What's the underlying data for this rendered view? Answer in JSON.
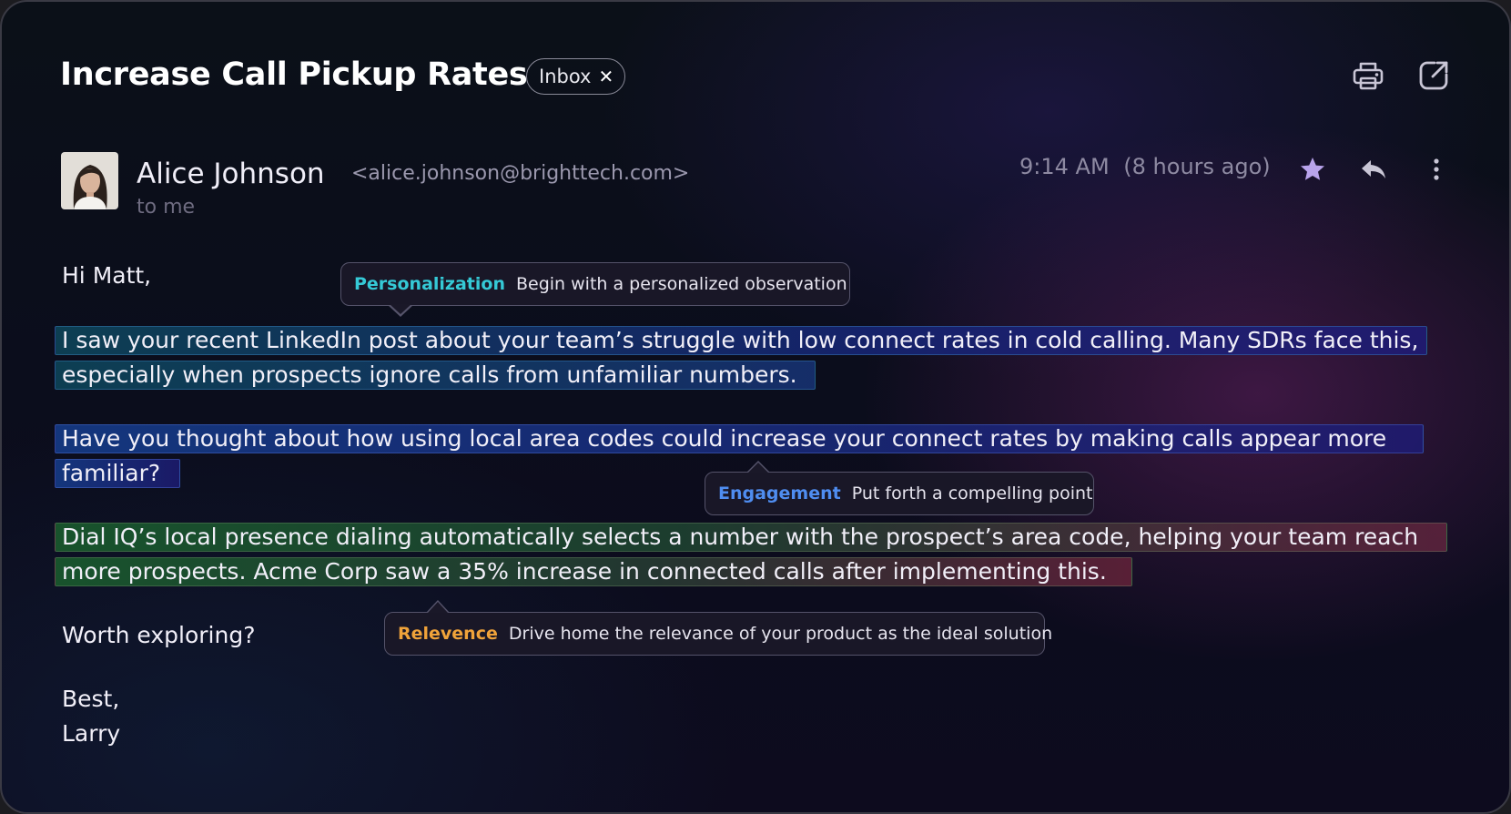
{
  "email": {
    "subject": "Increase Call Pickup Rates",
    "label_chip": "Inbox",
    "label_chip_close": "✕",
    "sender": {
      "name": "Alice Johnson",
      "email": "<alice.johnson@brighttech.com>",
      "recipient": "to me"
    },
    "time": "9:14 AM",
    "time_relative": "(8 hours ago)",
    "header_icons": [
      "printer-icon",
      "open-in-new-icon"
    ],
    "action_icons": [
      "star-icon",
      "reply-icon",
      "more-vertical-icon"
    ],
    "body": {
      "greeting": "Hi Matt,",
      "p1_line1": "I saw your recent LinkedIn post about your team’s struggle with low connect rates in cold calling. Many SDRs face this,",
      "p1_line2": "especially when prospects ignore calls from unfamiliar numbers.",
      "p2_line1": "Have you thought about how using local area codes could increase your connect rates by making calls appear more",
      "p2_line2": "familiar?",
      "p3_line1": "Dial IQ’s local presence dialing automatically selects a number with the prospect’s area code, helping your team reach",
      "p3_line2": "more prospects. Acme Corp saw a 35% increase in connected calls after implementing this.",
      "question": "Worth exploring?",
      "signoff": "Best,",
      "signature": "Larry"
    }
  },
  "annotations": [
    {
      "tag": "Personalization",
      "text": "Begin with a personalized observation",
      "color": "#35c9d6"
    },
    {
      "tag": "Engagement",
      "text": "Put forth a compelling point",
      "color": "#4f8df0"
    },
    {
      "tag": "Relevence",
      "text": "Drive home the relevance of your product as the ideal solution",
      "color": "#f0a33a"
    }
  ],
  "colors": {
    "star": "#b9a4ec",
    "icons": "#c9c6d6"
  }
}
